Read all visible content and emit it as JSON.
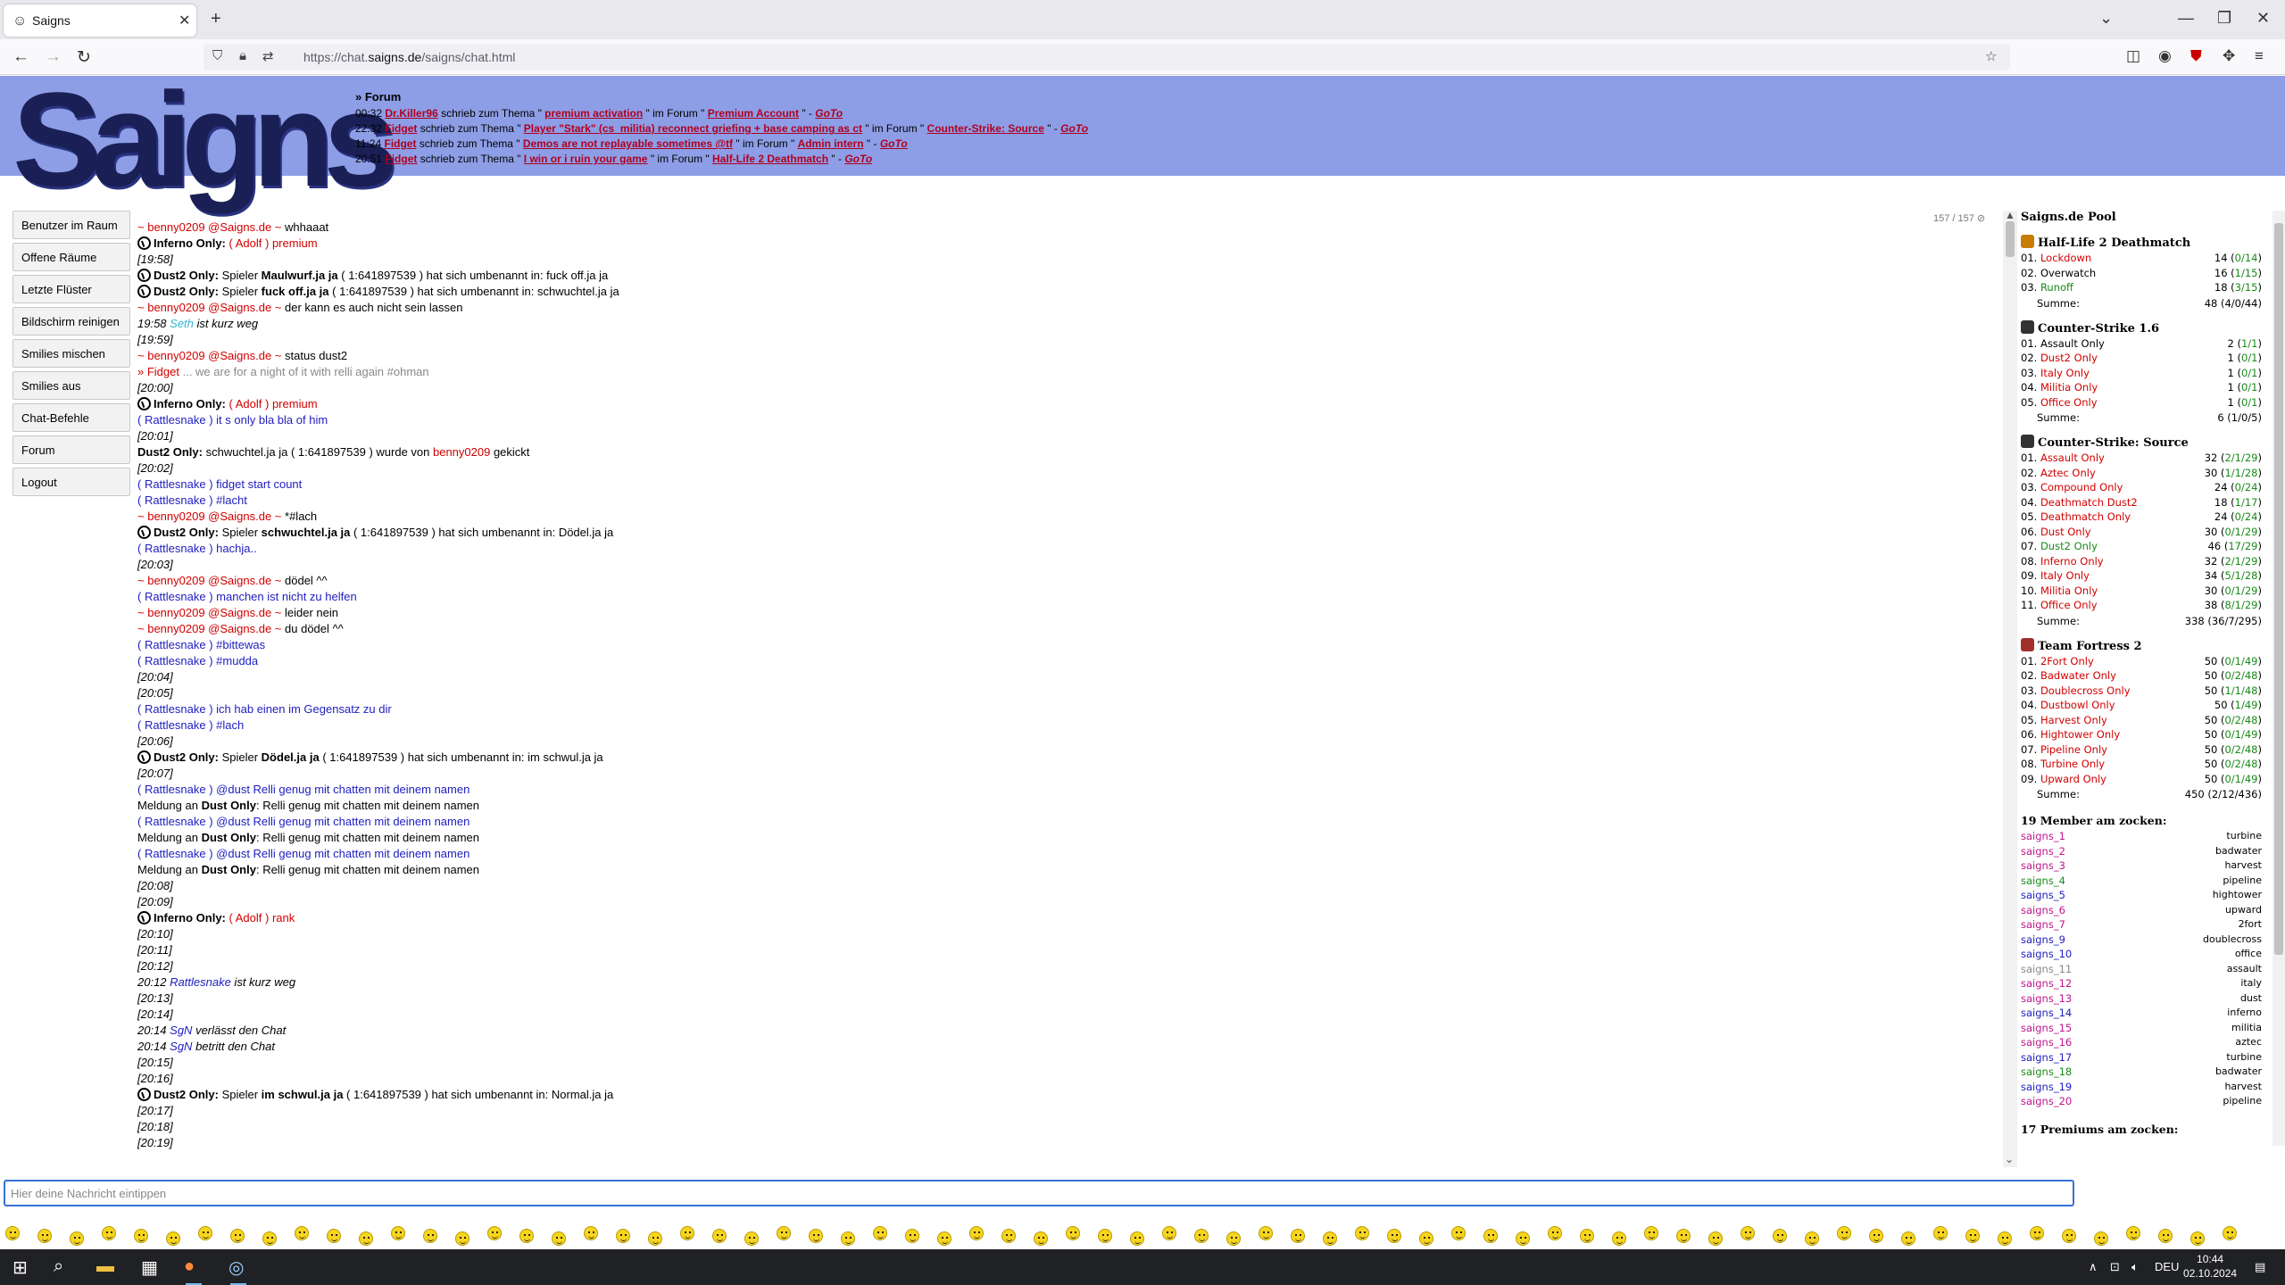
{
  "browser": {
    "tab_title": "Saigns",
    "url_prefix": "https://chat.",
    "url_host": "saigns.de",
    "url_path": "/saigns/chat.html"
  },
  "header": {
    "logo_text": "Saigns",
    "forum_title": "» Forum",
    "forum_rows": [
      {
        "time": "00:32",
        "user": "Dr.Killer96",
        "mid": " schrieb zum Thema \" ",
        "topic": "premium activation",
        "mid2": " \" im Forum \" ",
        "forum": "Premium Account",
        "end": " \" - ",
        "goto": "GoTo"
      },
      {
        "time": "22:32",
        "user": "Fidget",
        "mid": " schrieb zum Thema \" ",
        "topic": "Player \"Stark\" (cs_militia) reconnect griefing + base camping as ct",
        "mid2": " \" im Forum \" ",
        "forum": "Counter-Strike: Source",
        "end": " \" - ",
        "goto": "GoTo"
      },
      {
        "time": "11:24",
        "user": "Fidget",
        "mid": " schrieb zum Thema \" ",
        "topic": "Demos are not replayable sometimes @tf",
        "mid2": " \" im Forum \" ",
        "forum": "Admin intern",
        "end": " \" - ",
        "goto": "GoTo"
      },
      {
        "time": "20:51",
        "user": "Fidget",
        "mid": " schrieb zum Thema \" ",
        "topic": "I win or i ruin your game",
        "mid2": " \" im Forum \" ",
        "forum": "Half-Life 2 Deathmatch",
        "end": " \" - ",
        "goto": "GoTo"
      }
    ]
  },
  "menu": [
    "Benutzer im Raum",
    "Offene Räume",
    "Letzte Flüster",
    "Bildschirm reinigen",
    "Smilies mischen",
    "Smilies aus",
    "Chat-Befehle",
    "Forum",
    "Logout"
  ],
  "counter": "157 / 157 ⊘",
  "chat": [
    {
      "k": "u",
      "user": "benny0209",
      "text": "whhaaat"
    },
    {
      "k": "inf",
      "pre": "( ",
      "name": "Adolf",
      "post": " ) ",
      "extra": "premium"
    },
    {
      "k": "ts",
      "text": "[19:58]"
    },
    {
      "k": "ren",
      "old": "Maulwurf.ja ja",
      "id": " ( 1:641897539 ) hat sich umbenannt in: ",
      "neu": "fuck off.ja ja"
    },
    {
      "k": "ren",
      "old": "fuck off.ja ja",
      "id": " ( 1:641897539 ) hat sich umbenannt in: ",
      "neu": "schwuchtel.ja ja"
    },
    {
      "k": "u",
      "user": "benny0209",
      "text": "der kann es auch nicht sein lassen"
    },
    {
      "k": "away",
      "time": "19:58 ",
      "name": "Seth",
      "text": " ist kurz weg",
      "cls": "c-cyan"
    },
    {
      "k": "ts",
      "text": "[19:59]"
    },
    {
      "k": "u",
      "user": "benny0209",
      "text": "status dust2"
    },
    {
      "k": "fid",
      "user": "Fidget",
      "text": " ... we are for a night of it with relli again #ohman"
    },
    {
      "k": "ts",
      "text": "[20:00]"
    },
    {
      "k": "inf",
      "pre": "( ",
      "name": "Adolf",
      "post": " ) ",
      "extra": "premium"
    },
    {
      "k": "r",
      "text": "it s only bla bla of him"
    },
    {
      "k": "ts",
      "text": "[20:01]"
    },
    {
      "k": "kick",
      "name": "schwuchtel.ja ja",
      "id": " ( 1:641897539 ) wurde von ",
      "by": "benny0209",
      "end": " gekickt"
    },
    {
      "k": "ts",
      "text": "[20:02]"
    },
    {
      "k": "r",
      "text": "fidget start count"
    },
    {
      "k": "r",
      "text": "#lacht"
    },
    {
      "k": "u",
      "user": "benny0209",
      "text": "*#lach"
    },
    {
      "k": "ren",
      "old": "schwuchtel.ja ja",
      "id": " ( 1:641897539 ) hat sich umbenannt in: ",
      "neu": "Dödel.ja ja"
    },
    {
      "k": "r",
      "text": "hachja.."
    },
    {
      "k": "ts",
      "text": "[20:03]"
    },
    {
      "k": "u",
      "user": "benny0209",
      "text": "dödel ^^"
    },
    {
      "k": "r",
      "text": "manchen ist nicht zu helfen"
    },
    {
      "k": "u",
      "user": "benny0209",
      "text": "leider nein"
    },
    {
      "k": "u",
      "user": "benny0209",
      "text": "du dödel ^^"
    },
    {
      "k": "r",
      "text": "#bittewas"
    },
    {
      "k": "r",
      "text": "#mudda"
    },
    {
      "k": "ts",
      "text": "[20:04]"
    },
    {
      "k": "ts",
      "text": "[20:05]"
    },
    {
      "k": "r",
      "text": "ich hab einen im Gegensatz zu dir"
    },
    {
      "k": "r",
      "text": "#lach"
    },
    {
      "k": "ts",
      "text": "[20:06]"
    },
    {
      "k": "ren",
      "old": "Dödel.ja ja",
      "id": " ( 1:641897539 ) hat sich umbenannt in: ",
      "neu": "im schwul.ja ja"
    },
    {
      "k": "ts",
      "text": "[20:07]"
    },
    {
      "k": "r",
      "text": "@dust Relli genug mit chatten mit deinem namen"
    },
    {
      "k": "meld",
      "pre": "Meldung an ",
      "to": "Dust Only",
      "text": ": Relli genug mit chatten mit deinem namen"
    },
    {
      "k": "r",
      "text": "@dust Relli genug mit chatten mit deinem namen"
    },
    {
      "k": "meld",
      "pre": "Meldung an ",
      "to": "Dust Only",
      "text": ": Relli genug mit chatten mit deinem namen"
    },
    {
      "k": "r",
      "text": "@dust Relli genug mit chatten mit deinem namen"
    },
    {
      "k": "meld",
      "pre": "Meldung an ",
      "to": "Dust Only",
      "text": ": Relli genug mit chatten mit deinem namen"
    },
    {
      "k": "ts",
      "text": "[20:08]"
    },
    {
      "k": "ts",
      "text": "[20:09]"
    },
    {
      "k": "inf",
      "pre": "( ",
      "name": "Adolf",
      "post": " ) ",
      "extra": "rank"
    },
    {
      "k": "ts",
      "text": "[20:10]"
    },
    {
      "k": "ts",
      "text": "[20:11]"
    },
    {
      "k": "ts",
      "text": "[20:12]"
    },
    {
      "k": "away",
      "time": "20:12 ",
      "name": "Rattlesnake",
      "text": " ist kurz weg",
      "cls": "c-blue"
    },
    {
      "k": "ts",
      "text": "[20:13]"
    },
    {
      "k": "ts",
      "text": "[20:14]"
    },
    {
      "k": "away",
      "time": "20:14 ",
      "name": "SgN",
      "text": " verlässt den Chat",
      "cls": "c-blue"
    },
    {
      "k": "away",
      "time": "20:14 ",
      "name": "SgN",
      "text": " betritt den Chat",
      "cls": "c-blue"
    },
    {
      "k": "ts",
      "text": "[20:15]"
    },
    {
      "k": "ts",
      "text": "[20:16]"
    },
    {
      "k": "ren",
      "old": "im schwul.ja ja",
      "id": " ( 1:641897539 ) hat sich umbenannt in: ",
      "neu": "Normal.ja ja"
    },
    {
      "k": "ts",
      "text": "[20:17]"
    },
    {
      "k": "ts",
      "text": "[20:18]"
    },
    {
      "k": "ts",
      "text": "[20:19]"
    }
  ],
  "chat_labels": {
    "inferno": "Inferno Only:",
    "dust2": "Dust2 Only:",
    "spieler": " Spieler ",
    "at": " @Saigns.de ~ ",
    "tilde": "~ ",
    "rattle": "( Rattlesnake ) ",
    "fid_pre": "» "
  },
  "pool": {
    "title": "Saigns.de Pool",
    "sum_label": "Summe:",
    "categories": [
      {
        "title": "Half-Life 2 Deathmatch",
        "icon_color": "#c87d00",
        "servers": [
          {
            "n": "01.",
            "name": "Lockdown",
            "c": "#d10000",
            "cnt": "14 (",
            "g": "0/14",
            "e": ")"
          },
          {
            "n": "02.",
            "name": "Overwatch",
            "c": "#000",
            "cnt": "16 (",
            "g": "1/15",
            "e": ")"
          },
          {
            "n": "03.",
            "name": "Runoff",
            "c": "#1a8a1a",
            "cnt": "18 (",
            "g": "3/15",
            "e": ")"
          }
        ],
        "sum": "48 (",
        "sum_g": "4/0/44",
        "sum_e": ")"
      },
      {
        "title": "Counter-Strike 1.6",
        "icon_color": "#333",
        "servers": [
          {
            "n": "01.",
            "name": "Assault Only",
            "c": "#000",
            "cnt": "2 (",
            "g": "1/1",
            "e": ")"
          },
          {
            "n": "02.",
            "name": "Dust2 Only",
            "c": "#d10000",
            "cnt": "1 (",
            "g": "0/1",
            "e": ")"
          },
          {
            "n": "03.",
            "name": "Italy Only",
            "c": "#d10000",
            "cnt": "1 (",
            "g": "0/1",
            "e": ")"
          },
          {
            "n": "04.",
            "name": "Militia Only",
            "c": "#d10000",
            "cnt": "1 (",
            "g": "0/1",
            "e": ")"
          },
          {
            "n": "05.",
            "name": "Office Only",
            "c": "#d10000",
            "cnt": "1 (",
            "g": "0/1",
            "e": ")"
          }
        ],
        "sum": "6 (",
        "sum_g": "1/0/5",
        "sum_e": ")"
      },
      {
        "title": "Counter-Strike: Source",
        "icon_color": "#333",
        "servers": [
          {
            "n": "01.",
            "name": "Assault Only",
            "c": "#d10000",
            "cnt": "32 (",
            "g": "2/1/29",
            "e": ")"
          },
          {
            "n": "02.",
            "name": "Aztec Only",
            "c": "#d10000",
            "cnt": "30 (",
            "g": "1/1/28",
            "e": ")"
          },
          {
            "n": "03.",
            "name": "Compound Only",
            "c": "#d10000",
            "cnt": "24 (",
            "g": "0/24",
            "e": ")"
          },
          {
            "n": "04.",
            "name": "Deathmatch Dust2",
            "c": "#d10000",
            "cnt": "18 (",
            "g": "1/17",
            "e": ")"
          },
          {
            "n": "05.",
            "name": "Deathmatch Only",
            "c": "#d10000",
            "cnt": "24 (",
            "g": "0/24",
            "e": ")"
          },
          {
            "n": "06.",
            "name": "Dust Only",
            "c": "#d10000",
            "cnt": "30 (",
            "g": "0/1/29",
            "e": ")"
          },
          {
            "n": "07.",
            "name": "Dust2 Only",
            "c": "#1a8a1a",
            "cnt": "46 (",
            "g": "17/29",
            "e": ")"
          },
          {
            "n": "08.",
            "name": "Inferno Only",
            "c": "#d10000",
            "cnt": "32 (",
            "g": "2/1/29",
            "e": ")"
          },
          {
            "n": "09.",
            "name": "Italy Only",
            "c": "#d10000",
            "cnt": "34 (",
            "g": "5/1/28",
            "e": ")"
          },
          {
            "n": "10.",
            "name": "Militia Only",
            "c": "#d10000",
            "cnt": "30 (",
            "g": "0/1/29",
            "e": ")"
          },
          {
            "n": "11.",
            "name": "Office Only",
            "c": "#d10000",
            "cnt": "38 (",
            "g": "8/1/29",
            "e": ")"
          }
        ],
        "sum": "338 (",
        "sum_g": "36/7/295",
        "sum_e": ")"
      },
      {
        "title": "Team Fortress 2",
        "icon_color": "#a0302a",
        "servers": [
          {
            "n": "01.",
            "name": "2Fort Only",
            "c": "#d10000",
            "cnt": "50 (",
            "g": "0/1/49",
            "e": ")"
          },
          {
            "n": "02.",
            "name": "Badwater Only",
            "c": "#d10000",
            "cnt": "50 (",
            "g": "0/2/48",
            "e": ")"
          },
          {
            "n": "03.",
            "name": "Doublecross Only",
            "c": "#d10000",
            "cnt": "50 (",
            "g": "1/1/48",
            "e": ")"
          },
          {
            "n": "04.",
            "name": "Dustbowl Only",
            "c": "#d10000",
            "cnt": "50 (",
            "g": "1/49",
            "e": ")"
          },
          {
            "n": "05.",
            "name": "Harvest Only",
            "c": "#d10000",
            "cnt": "50 (",
            "g": "0/2/48",
            "e": ")"
          },
          {
            "n": "06.",
            "name": "Hightower Only",
            "c": "#d10000",
            "cnt": "50 (",
            "g": "0/1/49",
            "e": ")"
          },
          {
            "n": "07.",
            "name": "Pipeline Only",
            "c": "#d10000",
            "cnt": "50 (",
            "g": "0/2/48",
            "e": ")"
          },
          {
            "n": "08.",
            "name": "Turbine Only",
            "c": "#d10000",
            "cnt": "50 (",
            "g": "0/2/48",
            "e": ")"
          },
          {
            "n": "09.",
            "name": "Upward Only",
            "c": "#d10000",
            "cnt": "50 (",
            "g": "0/1/49",
            "e": ")"
          }
        ],
        "sum": "450 (",
        "sum_g": "2/12/436",
        "sum_e": ")"
      }
    ],
    "members_title": "19 Member am zocken:",
    "members": [
      {
        "name": "saigns_1",
        "c": "#c0168c",
        "map": "turbine"
      },
      {
        "name": "saigns_2",
        "c": "#c0168c",
        "map": "badwater"
      },
      {
        "name": "saigns_3",
        "c": "#c0168c",
        "map": "harvest"
      },
      {
        "name": "saigns_4",
        "c": "#1a8a1a",
        "map": "pipeline"
      },
      {
        "name": "saigns_5",
        "c": "#2020c0",
        "map": "hightower"
      },
      {
        "name": "saigns_6",
        "c": "#c0168c",
        "map": "upward"
      },
      {
        "name": "saigns_7",
        "c": "#c0168c",
        "map": "2fort"
      },
      {
        "name": "saigns_9",
        "c": "#2020c0",
        "map": "doublecross"
      },
      {
        "name": "saigns_10",
        "c": "#2020c0",
        "map": "office"
      },
      {
        "name": "saigns_11",
        "c": "#888",
        "map": "assault"
      },
      {
        "name": "saigns_12",
        "c": "#c0168c",
        "map": "italy"
      },
      {
        "name": "saigns_13",
        "c": "#c0168c",
        "map": "dust"
      },
      {
        "name": "saigns_14",
        "c": "#2020c0",
        "map": "inferno"
      },
      {
        "name": "saigns_15",
        "c": "#c0168c",
        "map": "militia"
      },
      {
        "name": "saigns_16",
        "c": "#c0168c",
        "map": "aztec"
      },
      {
        "name": "saigns_17",
        "c": "#2020c0",
        "map": "turbine"
      },
      {
        "name": "saigns_18",
        "c": "#1a8a1a",
        "map": "badwater"
      },
      {
        "name": "saigns_19",
        "c": "#2020c0",
        "map": "harvest"
      },
      {
        "name": "saigns_20",
        "c": "#c0168c",
        "map": "pipeline"
      }
    ],
    "premiums_title": "17 Premiums am zocken:"
  },
  "input": {
    "placeholder": "Hier deine Nachricht eintippen"
  },
  "smileys_count": 70,
  "taskbar": {
    "time": "10:44",
    "date": "02.10.2024",
    "lang": "DEU"
  }
}
